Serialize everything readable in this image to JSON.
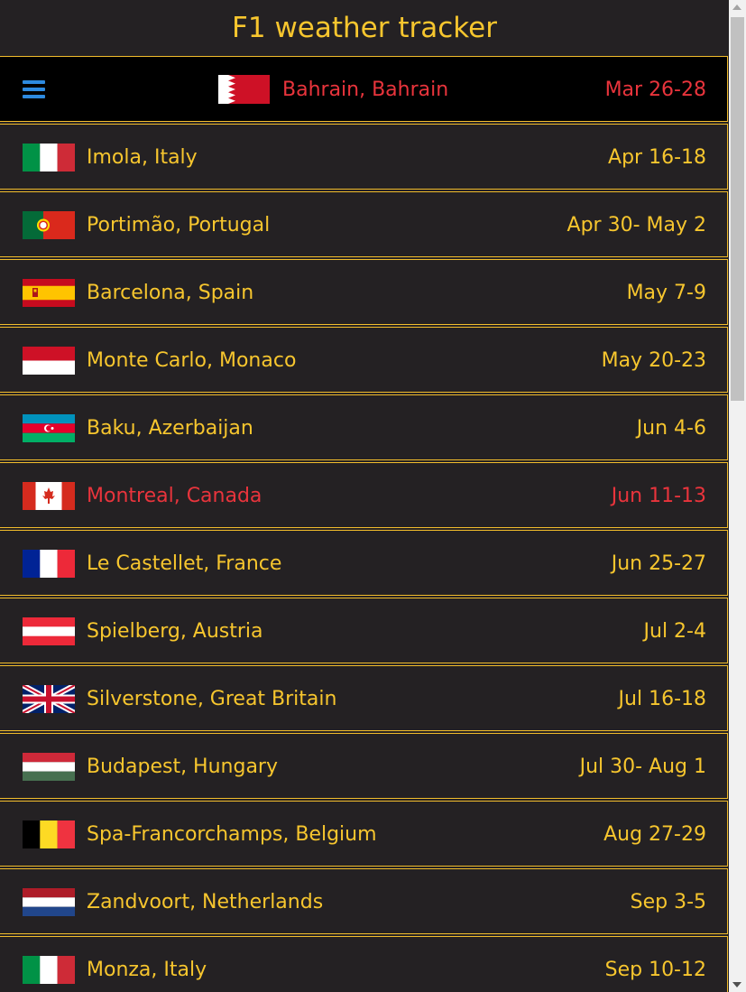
{
  "app": {
    "title": "F1 weather tracker"
  },
  "current": {
    "name": "Bahrain, Bahrain",
    "date": "Mar 26-28"
  },
  "races": [
    {
      "name": "Imola, Italy",
      "date": "Apr 16-18"
    },
    {
      "name": "Portimão, Portugal",
      "date": "Apr 30- May 2"
    },
    {
      "name": "Barcelona, Spain",
      "date": "May 7-9"
    },
    {
      "name": "Monte Carlo, Monaco",
      "date": "May 20-23"
    },
    {
      "name": "Baku, Azerbaijan",
      "date": "Jun 4-6"
    },
    {
      "name": "Montreal, Canada",
      "date": "Jun 11-13"
    },
    {
      "name": "Le Castellet, France",
      "date": "Jun 25-27"
    },
    {
      "name": "Spielberg, Austria",
      "date": "Jul 2-4"
    },
    {
      "name": "Silverstone, Great Britain",
      "date": "Jul 16-18"
    },
    {
      "name": "Budapest, Hungary",
      "date": "Jul 30- Aug 1"
    },
    {
      "name": "Spa-Francorchamps, Belgium",
      "date": "Aug 27-29"
    },
    {
      "name": "Zandvoort, Netherlands",
      "date": "Sep 3-5"
    },
    {
      "name": "Monza, Italy",
      "date": "Sep 10-12"
    }
  ],
  "colors": {
    "accent": "#f7c62e",
    "highlight": "#e9343c",
    "menu_icon": "#2d8ae0",
    "background": "#242123"
  },
  "icons": {
    "menu": "hamburger-menu-icon"
  }
}
